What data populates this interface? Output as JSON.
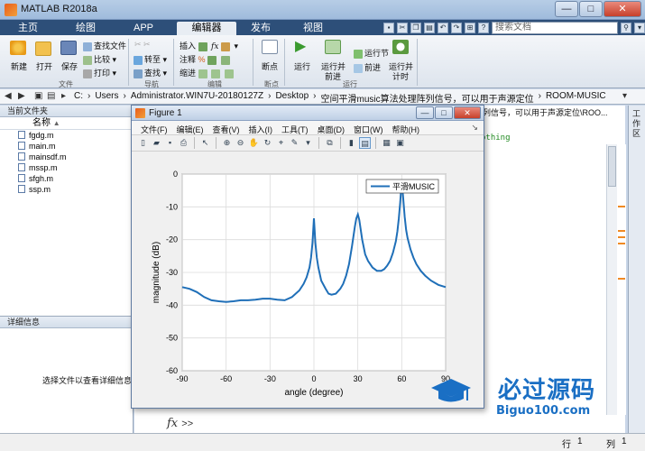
{
  "window": {
    "title": "MATLAB R2018a"
  },
  "tabs": [
    {
      "label": "主页"
    },
    {
      "label": "绘图"
    },
    {
      "label": "APP"
    },
    {
      "label": "编辑器"
    },
    {
      "label": "发布"
    },
    {
      "label": "视图"
    }
  ],
  "search": {
    "placeholder": "搜索文档"
  },
  "ribbon": {
    "file_section": {
      "label": "文件",
      "new": "新建",
      "open": "打开",
      "save": "保存",
      "find_files": "查找文件",
      "compare": "比较",
      "print": "打印"
    },
    "nav_section": {
      "label": "导航",
      "goto": "转至",
      "find": "查找"
    },
    "edit_section": {
      "label": "编辑",
      "insert": "插入",
      "comment": "注释",
      "indent": "缩进"
    },
    "breakpoint_section": {
      "label": "断点",
      "breakpoints": "断点"
    },
    "run_section": {
      "label": "运行",
      "run": "运行",
      "run_advance": "运行并",
      "run_advance_2": "前进",
      "run_section_btn": "运行节",
      "advance": "前进",
      "run_time": "运行并",
      "run_time_2": "计时"
    }
  },
  "address": {
    "crumbs": [
      "C:",
      "Users",
      "Administrator.WIN7U-20180127Z",
      "Desktop",
      "空间平滑music算法处理阵列信号，可以用于声源定位",
      "ROOM-MUSIC"
    ]
  },
  "left_panel": {
    "title": "当前文件夹",
    "column": "名称",
    "files": [
      "fgdg.m",
      "main.m",
      "mainsdf.m",
      "mssp.m",
      "sfgh.m",
      "ssp.m"
    ],
    "details_title": "详细信息",
    "details_msg": "选择文件以查看详细信息"
  },
  "editor": {
    "path_fragment": "列信号，可以用于声源定位\\ROO...",
    "code_fragment": "othing",
    "cmd_prompt": "fx",
    "cmd_chevron": ">>"
  },
  "right_tab": {
    "label": "工作区"
  },
  "status": {
    "row_label": "行",
    "row": "1",
    "col_label": "列",
    "col": "1"
  },
  "figure": {
    "title": "Figure 1",
    "menu": [
      "文件(F)",
      "编辑(E)",
      "查看(V)",
      "插入(I)",
      "工具(T)",
      "桌面(D)",
      "窗口(W)",
      "帮助(H)"
    ]
  },
  "chart_data": {
    "type": "line",
    "title": "",
    "xlabel": "angle (degree)",
    "ylabel": "magnitude (dB)",
    "xlim": [
      -90,
      90
    ],
    "ylim": [
      -60,
      0
    ],
    "xticks": [
      -90,
      -60,
      -30,
      0,
      30,
      60,
      90
    ],
    "yticks": [
      0,
      -10,
      -20,
      -30,
      -40,
      -50,
      -60
    ],
    "grid": true,
    "legend_position": "top-right",
    "color": "#1f6fb8",
    "series": [
      {
        "name": "平滑MUSIC",
        "x": [
          -90,
          -85,
          -80,
          -75,
          -70,
          -65,
          -60,
          -55,
          -50,
          -45,
          -40,
          -35,
          -30,
          -25,
          -20,
          -15,
          -10,
          -7,
          -5,
          -3,
          -2,
          -1,
          0,
          1,
          2,
          3,
          5,
          8,
          10,
          12,
          15,
          18,
          20,
          22,
          24,
          26,
          27,
          28,
          29,
          30,
          31,
          32,
          33,
          35,
          37,
          40,
          43,
          46,
          48,
          50,
          52,
          54,
          56,
          57,
          58,
          59,
          60,
          61,
          62,
          63,
          64,
          66,
          68,
          70,
          73,
          76,
          80,
          85,
          90
        ],
        "y": [
          -34.5,
          -35,
          -36,
          -37.5,
          -38.5,
          -38.8,
          -39,
          -38.8,
          -38.5,
          -38.5,
          -38.3,
          -38,
          -38,
          -38.3,
          -38.5,
          -37.5,
          -35.5,
          -33.5,
          -31.5,
          -28.5,
          -25.5,
          -21,
          -13.5,
          -21,
          -25.5,
          -28.5,
          -32.5,
          -35,
          -36.5,
          -36.8,
          -36.5,
          -35,
          -33.5,
          -31,
          -27.5,
          -22,
          -19,
          -16,
          -13.5,
          -12.3,
          -14,
          -17,
          -20,
          -24.5,
          -26.5,
          -28.5,
          -29.5,
          -29.5,
          -29,
          -28,
          -26.5,
          -24,
          -20.5,
          -17.5,
          -13.5,
          -8.5,
          -1.8,
          -7.5,
          -13,
          -17,
          -19.5,
          -23,
          -25.5,
          -27.5,
          -29.5,
          -31,
          -32.5,
          -33.8,
          -34.5
        ]
      }
    ]
  },
  "watermark": {
    "text": "必过源码",
    "sub": "Biguo100.com"
  },
  "colors": {
    "accent": "#2d4f79",
    "line": "#1f6fb8",
    "watermark": "#1a6fc4"
  }
}
